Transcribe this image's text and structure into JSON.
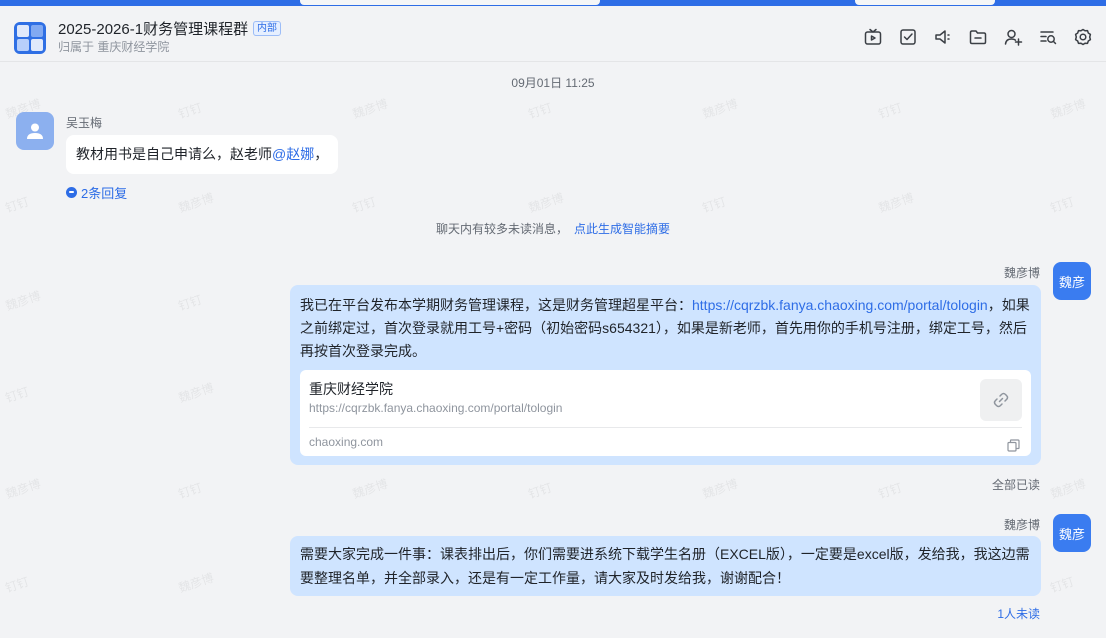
{
  "header": {
    "group_title": "2025-2026-1财务管理课程群",
    "tag": "内部",
    "subtitle": "归属于 重庆财经学院",
    "tools": [
      "tv-icon",
      "checkbox-icon",
      "announcement-icon",
      "folder-icon",
      "add-member-icon",
      "search-history-icon",
      "settings-icon"
    ]
  },
  "watermark": [
    "魏彦博",
    "钉钉"
  ],
  "messages": {
    "timestamp": "09月01日 11:25",
    "m1": {
      "sender": "吴玉梅",
      "text_before": "教材用书是自己申请么，赵老师",
      "mention": "@赵娜",
      "text_after": "，",
      "replies": "2条回复"
    },
    "unread_tip": {
      "text": "聊天内有较多未读消息，",
      "action": "点此生成智能摘要"
    },
    "m2": {
      "sender": "魏彦博",
      "avatar": "魏彦",
      "text_before": "我已在平台发布本学期财务管理课程，这是财务管理超星平台：",
      "link": "https://cqrzbk.fanya.chaoxing.com/portal/tologin",
      "text_after": "，如果之前绑定过，首次登录就用工号+密码（初始密码s654321），如果是新老师，首先用你的手机号注册，绑定工号，然后再按首次登录完成。",
      "card": {
        "title": "重庆财经学院",
        "url": "https://cqrzbk.fanya.chaoxing.com/portal/tologin",
        "domain": "chaoxing.com"
      },
      "read_status": "全部已读"
    },
    "m3": {
      "sender": "魏彦博",
      "avatar": "魏彦",
      "text": "需要大家完成一件事：课表排出后，你们需要进系统下载学生名册（EXCEL版），一定要是excel版，发给我，我这边需要整理名单，并全部录入，还是有一定工作量，请大家及时发给我，谢谢配合！",
      "read_status": "1人未读"
    }
  },
  "colors": {
    "accent": "#2e6de6",
    "bubble_self": "#cfe4ff",
    "background": "#f2f3f5"
  }
}
